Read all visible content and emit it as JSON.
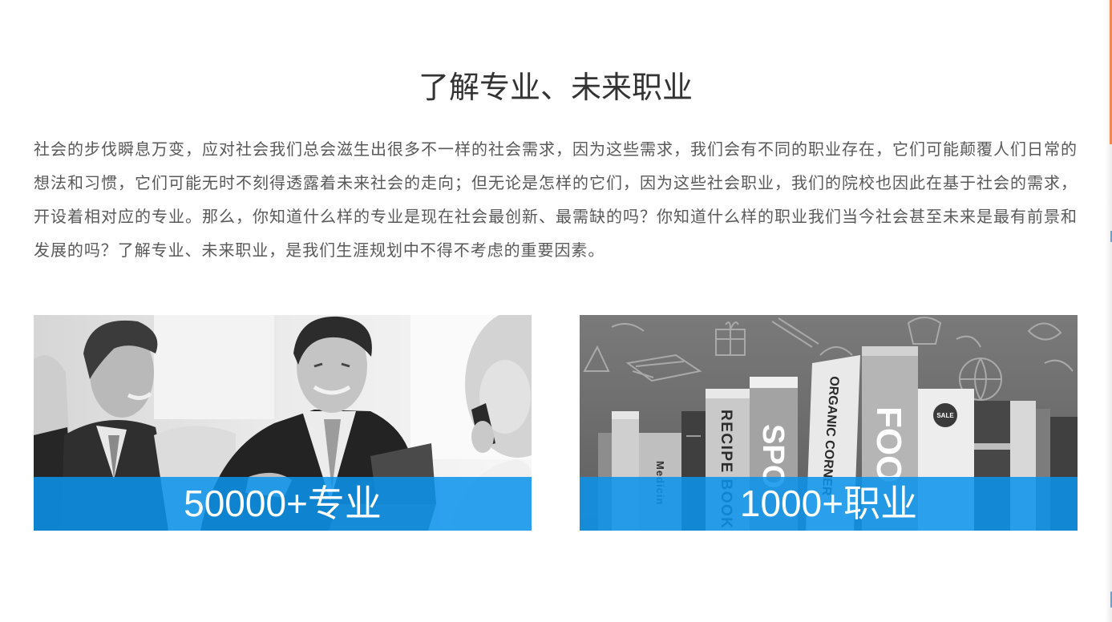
{
  "section": {
    "title": "了解专业、未来职业",
    "intro": "社会的步伐瞬息万变，应对社会我们总会滋生出很多不一样的社会需求，因为这些需求，我们会有不同的职业存在，它们可能颠覆人们日常的想法和习惯，它们可能无时不刻得透露着未来社会的走向；但无论是怎样的它们，因为这些社会职业，我们的院校也因此在基于社会的需求，开设着相对应的专业。那么，你知道什么样的专业是现在社会最创新、最需缺的吗？你知道什么样的职业我们当今社会甚至未来是最有前景和发展的吗？了解专业、未来职业，是我们生涯规划中不得不考虑的重要因素。"
  },
  "cards": [
    {
      "label": "50000+专业"
    },
    {
      "label": "1000+职业",
      "spine": {
        "recipe": "RECIPE BOOK",
        "spo": "SPO",
        "organic": "ORGANIC CORNER",
        "foo": "FOO",
        "sale": "SALE",
        "medicin": "Medicin"
      }
    }
  ],
  "colors": {
    "title": "#333333",
    "body": "#595959",
    "band": "#0b93ec",
    "band_text": "#ffffff",
    "edge_accent": "#ef8a4c",
    "edge_marker": "#5aa5e8"
  }
}
